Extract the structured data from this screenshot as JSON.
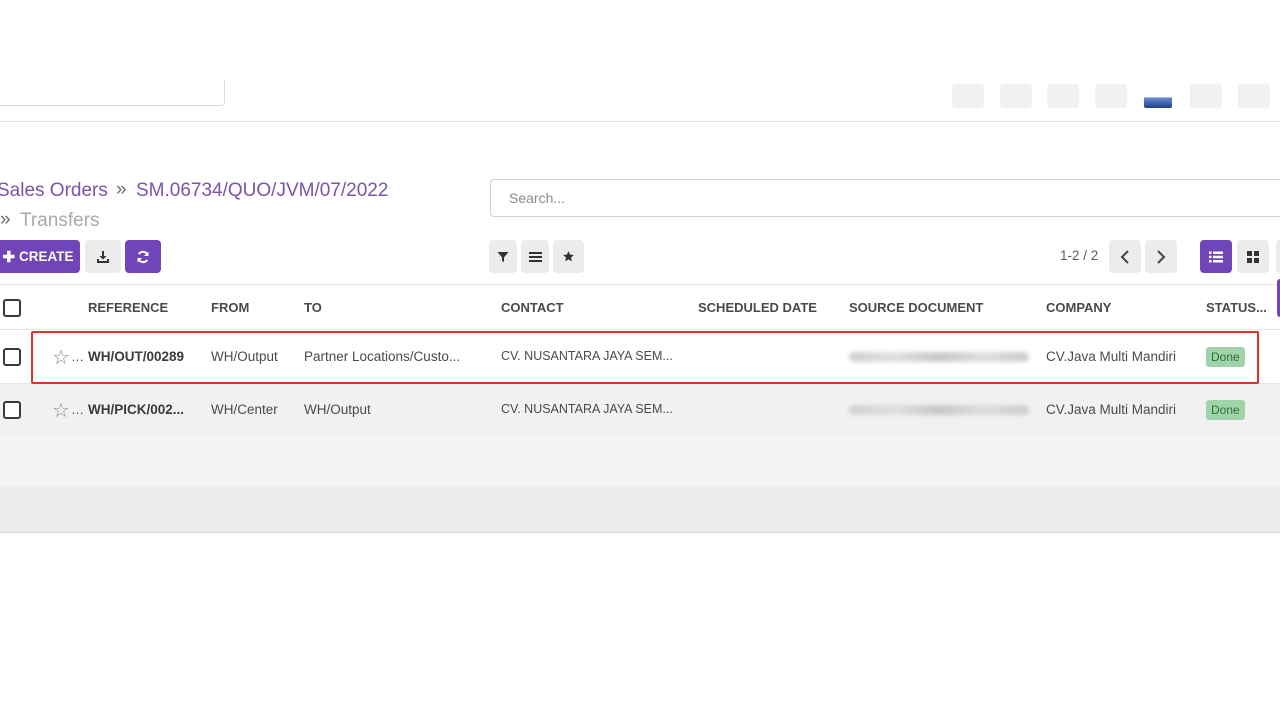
{
  "breadcrumb": {
    "root": "Sales Orders",
    "order": "SM.06734/QUO/JVM/07/2022",
    "current": "Transfers"
  },
  "search": {
    "placeholder": "Search..."
  },
  "toolbar": {
    "create_label": "CREATE",
    "pager": "1-2 / 2"
  },
  "table": {
    "columns": [
      "REFERENCE",
      "FROM",
      "TO",
      "CONTACT",
      "SCHEDULED DATE",
      "SOURCE DOCUMENT",
      "COMPANY",
      "STATUS..."
    ],
    "rows": [
      {
        "reference": "WH/OUT/00289",
        "from": "WH/Output",
        "to": "Partner Locations/Custo...",
        "contact": "CV. NUSANTARA JAYA SEM...",
        "scheduled_date": "",
        "company": "CV.Java Multi Mandiri",
        "status": "Done"
      },
      {
        "reference": "WH/PICK/002...",
        "from": "WH/Center",
        "to": "WH/Output",
        "contact": "CV. NUSANTARA JAYA SEM...",
        "scheduled_date": "",
        "company": "CV.Java Multi Mandiri",
        "status": "Done"
      }
    ]
  },
  "colors": {
    "accent": "#6f45b8",
    "highlight": "#e0302a",
    "done_badge": "#9fd3a9"
  },
  "icons": {
    "download": "download-icon",
    "refresh": "refresh-icon",
    "filter": "filter-icon",
    "group": "list-icon",
    "favorite": "star-icon",
    "prev": "chevron-left-icon",
    "next": "chevron-right-icon",
    "list_view": "list-view-icon",
    "kanban_view": "kanban-view-icon"
  }
}
